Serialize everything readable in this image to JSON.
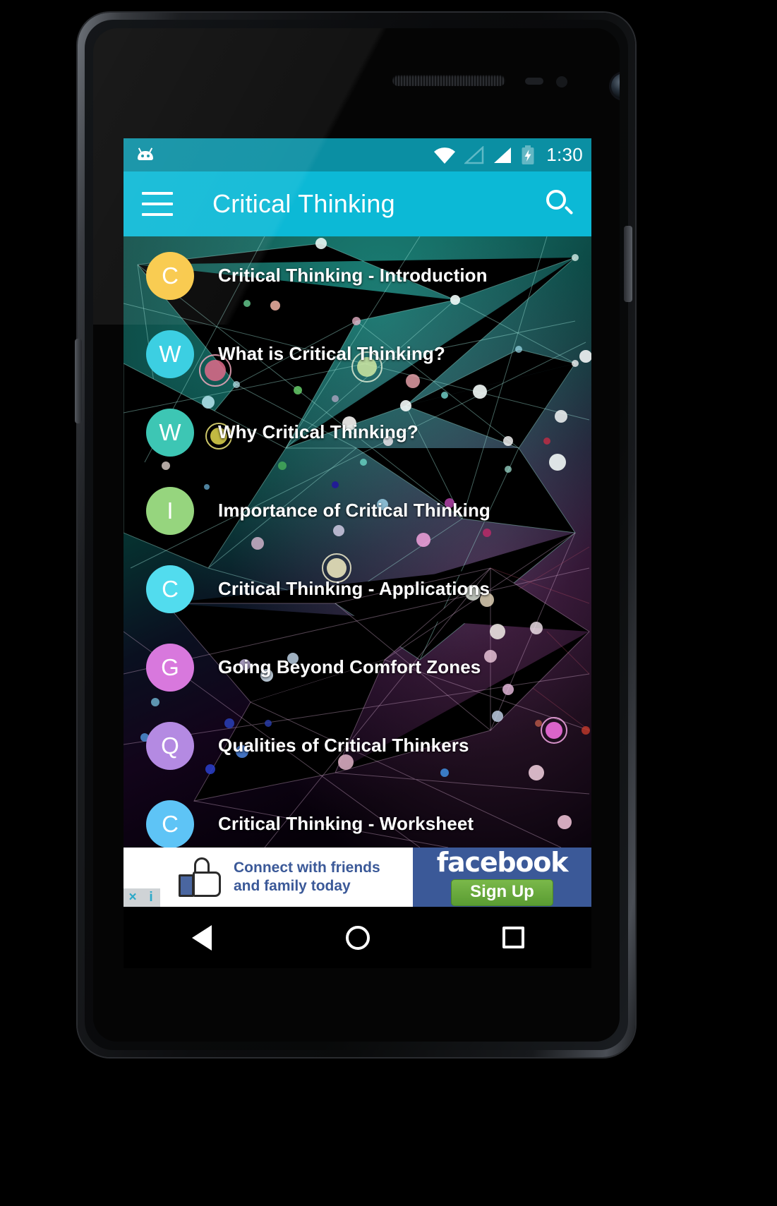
{
  "status_bar": {
    "robot_icon": "android-robot-icon",
    "wifi_icon": "wifi-icon",
    "signal_empty_icon": "signal-empty-icon",
    "signal_full_icon": "signal-full-icon",
    "battery_icon": "battery-charging-icon",
    "time": "1:30"
  },
  "toolbar": {
    "menu_icon": "hamburger-menu-icon",
    "title": "Critical Thinking",
    "search_icon": "search-icon",
    "background_color": "#0cb9d6"
  },
  "list": {
    "items": [
      {
        "initial": "C",
        "label": "Critical Thinking - Introduction",
        "color": "#f9c846"
      },
      {
        "initial": "W",
        "label": "What is Critical Thinking?",
        "color": "#3ccfe2"
      },
      {
        "initial": "W",
        "label": "Why Critical Thinking?",
        "color": "#3dc6b4"
      },
      {
        "initial": "I",
        "label": "Importance of Critical Thinking",
        "color": "#96d57e"
      },
      {
        "initial": "C",
        "label": "Critical Thinking - Applications",
        "color": "#52dcee"
      },
      {
        "initial": "G",
        "label": "Going Beyond Comfort Zones",
        "color": "#d878dd"
      },
      {
        "initial": "Q",
        "label": "Qualities of Critical Thinkers",
        "color": "#b48ae2"
      },
      {
        "initial": "C",
        "label": "Critical Thinking - Worksheet",
        "color": "#5ec4f6"
      }
    ]
  },
  "ad": {
    "headline_line1": "Connect with friends",
    "headline_line2": "and family today",
    "thumb_icon": "thumbs-up-icon",
    "brand": "facebook",
    "cta": "Sign Up",
    "close_badge": "×",
    "info_badge": "i",
    "brand_color": "#3b5998",
    "cta_color": "#5a9c32"
  },
  "nav_bar": {
    "back_icon": "back-triangle-icon",
    "home_icon": "home-circle-icon",
    "recents_icon": "recents-square-icon"
  }
}
